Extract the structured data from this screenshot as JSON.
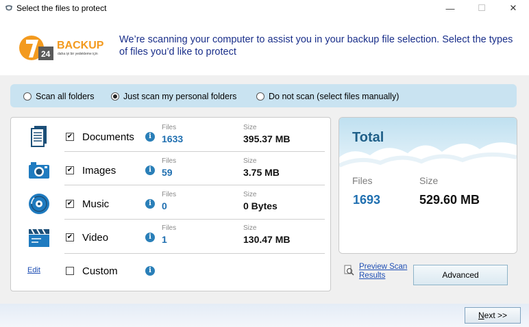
{
  "window": {
    "title": "Select the files to protect",
    "minimize": "—",
    "maximize": "☐",
    "close": "✕"
  },
  "header": {
    "logo_text": "BACKUP",
    "logo_number": "7",
    "logo_number2": "24",
    "logo_tagline": "daha iyi bir yedekleme için",
    "message": "We’re scanning your computer to assist you in your backup file selection. Select the types of files you’d like to protect"
  },
  "scan_options": [
    {
      "label": "Scan all folders",
      "selected": false
    },
    {
      "label": "Just scan my personal folders",
      "selected": true
    },
    {
      "label": "Do not scan (select files manually)",
      "selected": false
    }
  ],
  "categories": {
    "files_label": "Files",
    "size_label": "Size",
    "items": [
      {
        "name": "Documents",
        "checked": true,
        "files": "1633",
        "size": "395.37 MB",
        "icon": "document-icon"
      },
      {
        "name": "Images",
        "checked": true,
        "files": "59",
        "size": "3.75 MB",
        "icon": "camera-icon"
      },
      {
        "name": "Music",
        "checked": true,
        "files": "0",
        "size": "0 Bytes",
        "icon": "disc-icon"
      },
      {
        "name": "Video",
        "checked": true,
        "files": "1",
        "size": "130.47 MB",
        "icon": "clapperboard-icon"
      },
      {
        "name": "Custom",
        "checked": false,
        "files": "",
        "size": "",
        "icon": ""
      }
    ],
    "edit_link": "Edit",
    "info_glyph": "i"
  },
  "total": {
    "title": "Total",
    "files_label": "Files",
    "size_label": "Size",
    "files": "1693",
    "size": "529.60 MB"
  },
  "preview_link": "Preview Scan Results",
  "advanced_button": "Advanced",
  "next_button": {
    "underlined": "N",
    "rest": "ext >>"
  },
  "colors": {
    "accent_blue": "#1f6fb0",
    "header_text": "#1a2f8a",
    "scanbar_bg": "#c9e3f1",
    "logo_orange": "#f39a1e"
  }
}
